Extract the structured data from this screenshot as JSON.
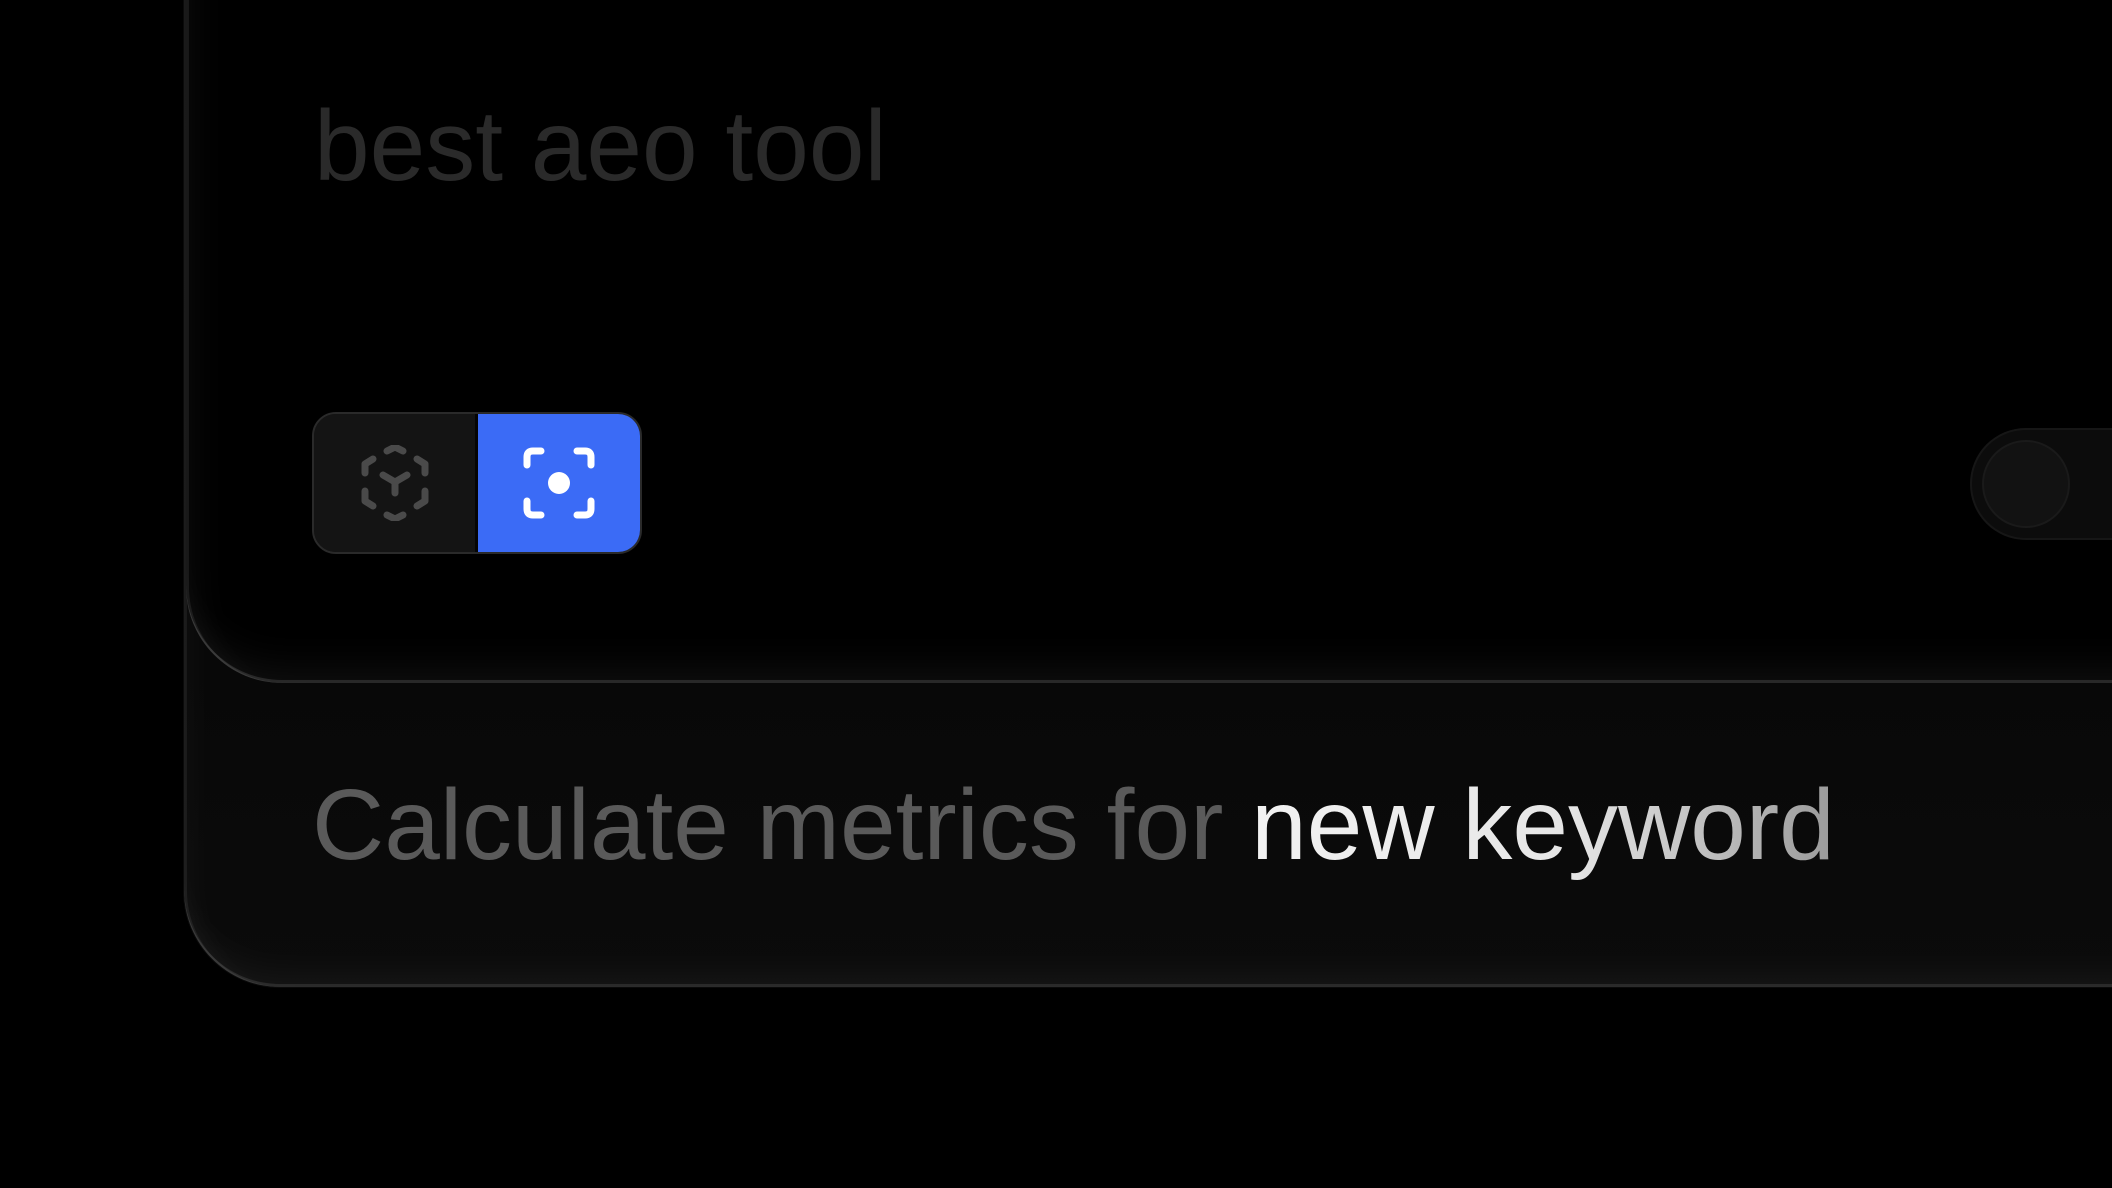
{
  "input": {
    "query": "best aeo tool"
  },
  "mode_toggle": {
    "options": [
      {
        "icon": "dashed-cube-icon",
        "active": false
      },
      {
        "icon": "focus-target-icon",
        "active": true
      }
    ],
    "active_color": "#3b6bf6"
  },
  "footer": {
    "prefix": "Calculate metrics for ",
    "highlight": "new keyword"
  }
}
